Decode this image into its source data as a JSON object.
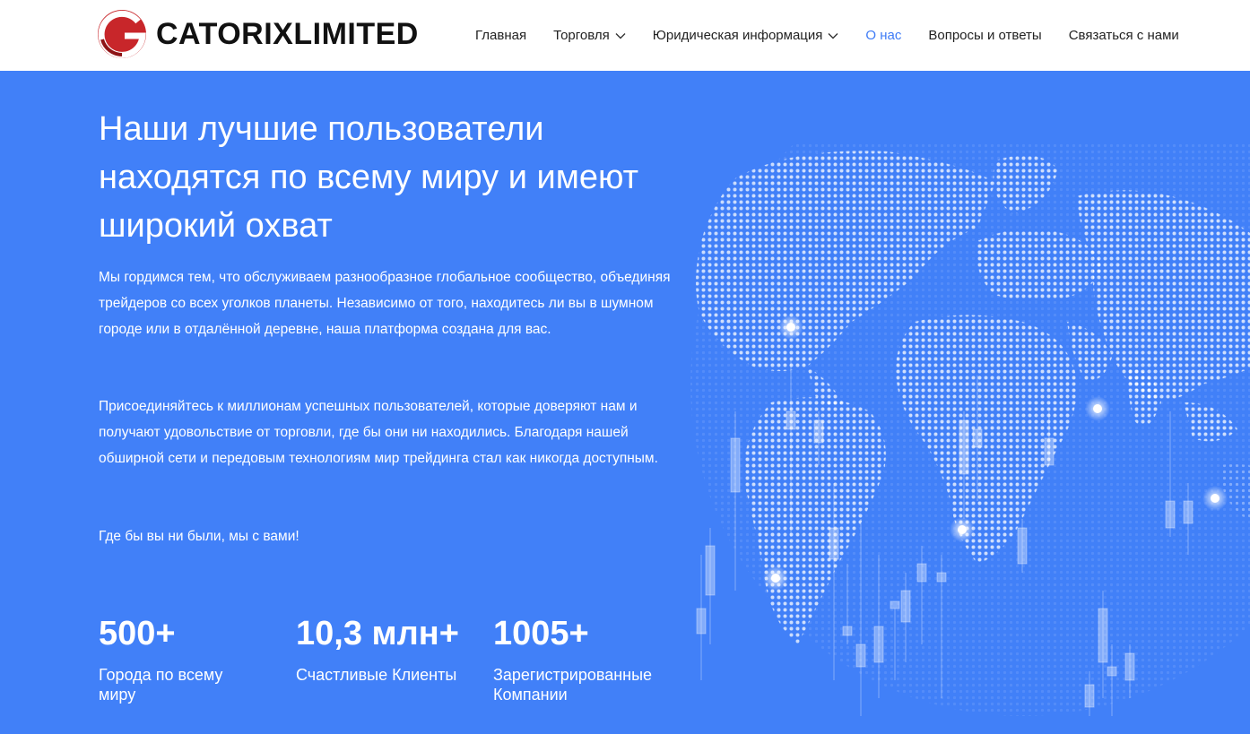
{
  "brand": {
    "name": "CATORIXLIMITED",
    "logo_icon": "g-circle-logo",
    "colors": {
      "logo_dark": "#b31d20",
      "logo_light": "#e03a32",
      "accent": "#3e7bf6",
      "hero_bg": "#4180f8"
    }
  },
  "nav": {
    "items": [
      {
        "label": "Главная",
        "dropdown": false,
        "active": false
      },
      {
        "label": "Торговля",
        "dropdown": true,
        "active": false
      },
      {
        "label": "Юридическая информация",
        "dropdown": true,
        "active": false
      },
      {
        "label": "О нас",
        "dropdown": false,
        "active": true
      },
      {
        "label": "Вопросы и ответы",
        "dropdown": false,
        "active": false
      },
      {
        "label": "Связаться с нами",
        "dropdown": false,
        "active": false
      }
    ]
  },
  "hero": {
    "title": "Наши лучшие пользователи находятся по всему миру и имеют широкий охват",
    "paragraphs": [
      "Мы гордимся тем, что обслуживаем разнообразное глобальное сообщество, объединяя трейдеров со всех уголков планеты. Независимо от того, находитесь ли вы в шумном городе или в отдалённой деревне, наша платформа создана для вас.",
      "Присоединяйтесь к миллионам успешных пользователей, которые доверяют нам и получают удовольствие от торговли, где бы они ни находились. Благодаря нашей обширной сети и передовым технологиям мир трейдинга стал как никогда доступным.",
      "Где бы вы ни были, мы с вами!"
    ],
    "illustration": "dotted-globe-with-candlesticks"
  },
  "stats": [
    {
      "value": "500+",
      "label": "Города по всему миру"
    },
    {
      "value": "10,3 млн+",
      "label": "Счастливые Клиенты"
    },
    {
      "value": "1005+",
      "label": "Зарегистрированные Компании"
    }
  ]
}
